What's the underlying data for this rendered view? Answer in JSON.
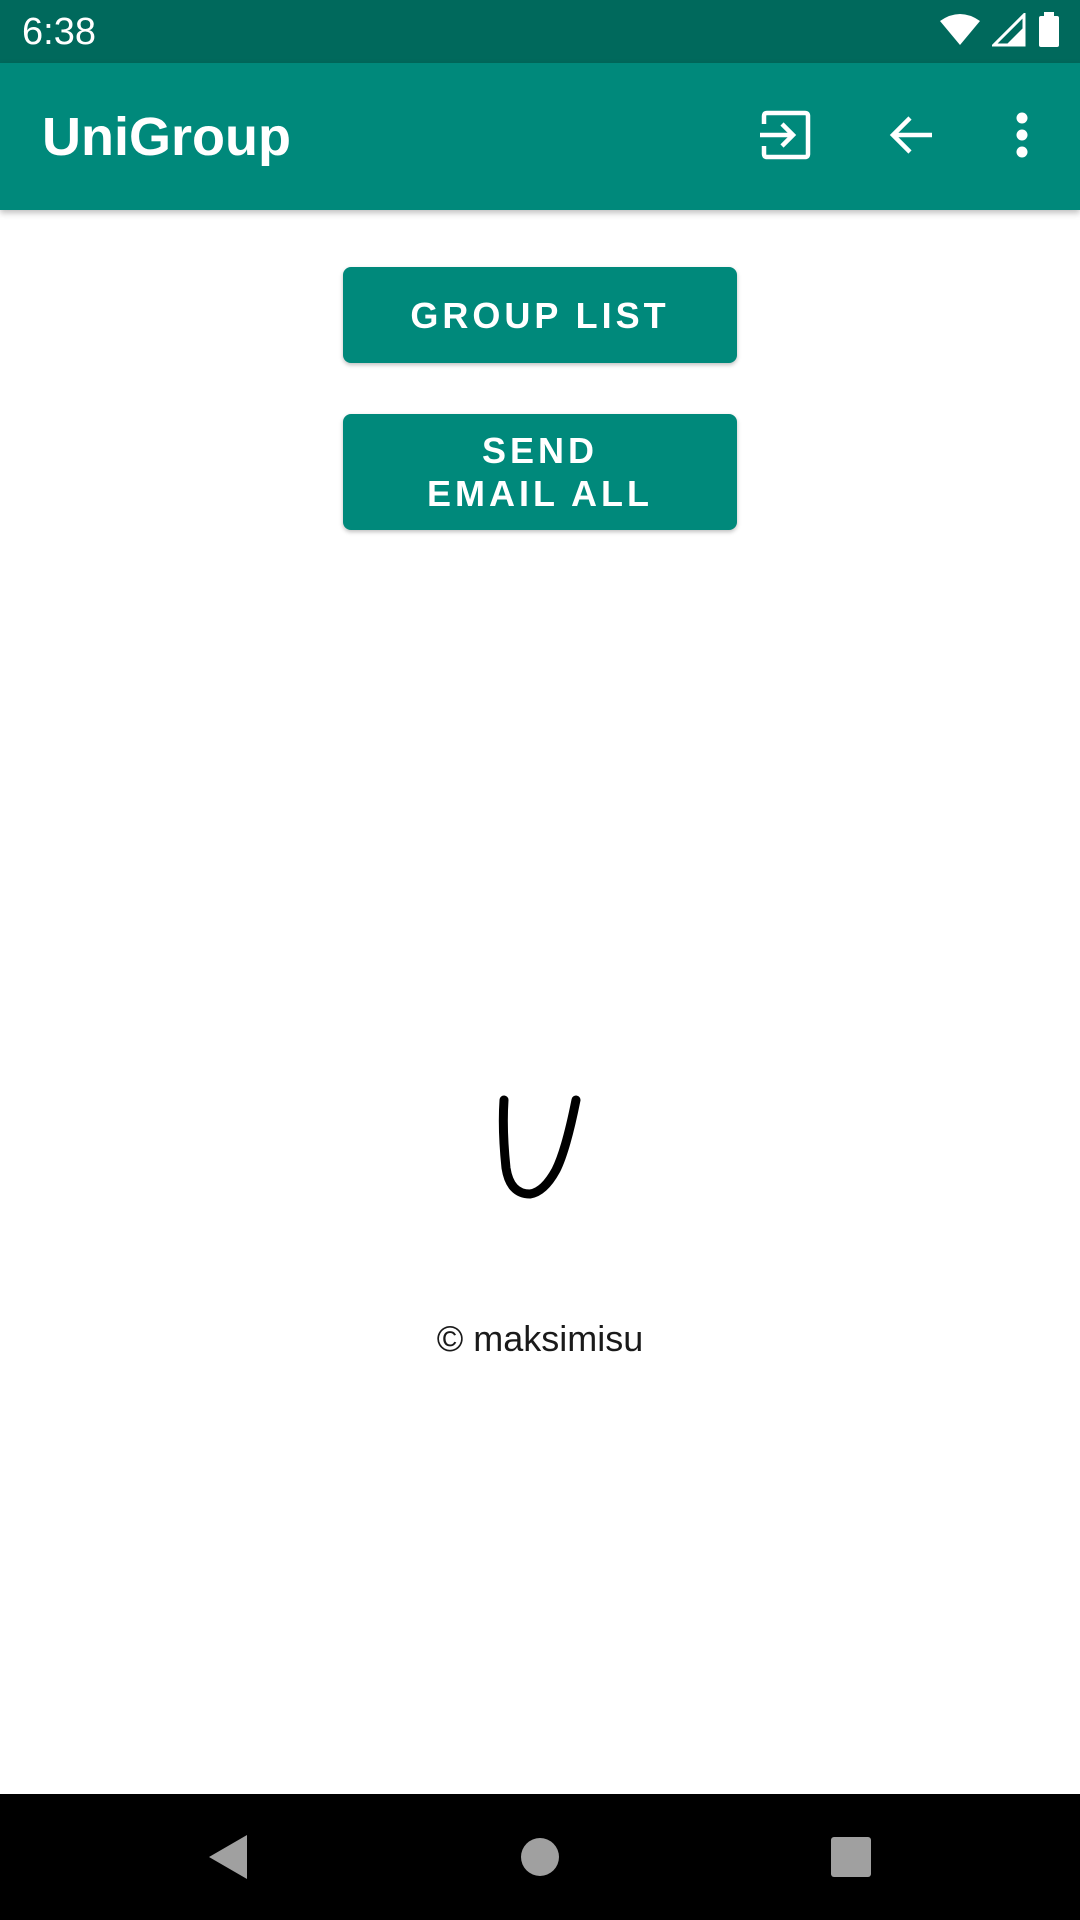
{
  "status_bar": {
    "time": "6:38",
    "icons": [
      "wifi-icon",
      "cell-signal-icon",
      "battery-icon"
    ]
  },
  "app_bar": {
    "title": "UniGroup",
    "actions": [
      "login-icon",
      "arrow-back-icon",
      "more-vert-icon"
    ]
  },
  "main": {
    "group_list_label": "GROUP LIST",
    "send_email_label": "SEND EMAIL ALL",
    "logo_letter": "U",
    "copyright": "© maksimisu"
  },
  "nav_bar": {
    "buttons": [
      "back-triangle-icon",
      "home-circle-icon",
      "recents-square-icon"
    ]
  },
  "colors": {
    "status_bar": "#00695c",
    "app_bar": "#00897b",
    "button": "#00897b",
    "nav_bar": "#000000"
  }
}
